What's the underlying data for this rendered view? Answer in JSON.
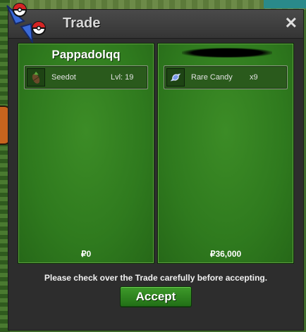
{
  "window": {
    "title": "Trade",
    "close_symbol": "✕"
  },
  "left_side": {
    "trainer_name": "Pappadolqq",
    "offer": {
      "name": "Seedot",
      "level": "Lvl: 19",
      "icon": "seedot-icon"
    },
    "money": "₽0"
  },
  "right_side": {
    "trainer_name_redacted": true,
    "offer": {
      "name": "Rare Candy",
      "quantity": "x9",
      "icon": "rare-candy-icon"
    },
    "money": "₽36,000"
  },
  "notice": "Please check over the Trade carefully before accepting.",
  "accept_label": "Accept",
  "colors": {
    "panel_green": "#2f7a1e",
    "button_green": "#2e8a20",
    "window_dark": "#2d2d2d"
  }
}
